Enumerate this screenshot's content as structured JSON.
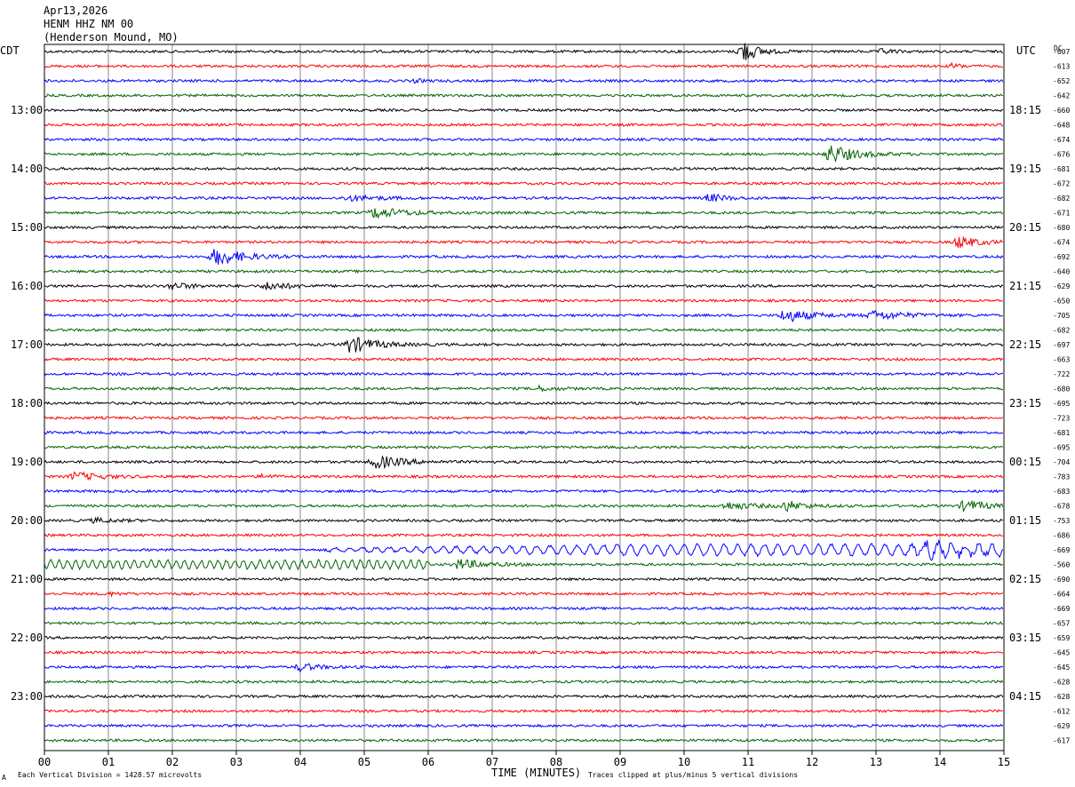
{
  "header": {
    "date": "Apr13,2026",
    "station": "HENM HHZ NM 00",
    "location": "(Henderson Mound, MO)"
  },
  "left_timezone": "CDT",
  "right_timezone": "UTC",
  "dc_label": "DC",
  "footer": {
    "xlabel": "TIME (MINUTES)",
    "scale_note": "Each Vertical Division = 1428.57 microvolts",
    "clip_note": "Traces clipped at plus/minus 5 vertical divisions",
    "corner_mark": "A"
  },
  "chart_data": {
    "type": "line",
    "subtype": "helicorder",
    "xlabel": "TIME (MINUTES)",
    "xlim": [
      0,
      15
    ],
    "x_ticks": [
      "00",
      "01",
      "02",
      "03",
      "04",
      "05",
      "06",
      "07",
      "08",
      "09",
      "10",
      "11",
      "12",
      "13",
      "14",
      "15"
    ],
    "trace_colors": [
      "#000000",
      "#ff0000",
      "#0000ff",
      "#006400"
    ],
    "left_hour_labels": [
      {
        "row": 4,
        "label": "13:00"
      },
      {
        "row": 8,
        "label": "14:00"
      },
      {
        "row": 12,
        "label": "15:00"
      },
      {
        "row": 16,
        "label": "16:00"
      },
      {
        "row": 20,
        "label": "17:00"
      },
      {
        "row": 24,
        "label": "18:00"
      },
      {
        "row": 28,
        "label": "19:00"
      },
      {
        "row": 32,
        "label": "20:00"
      },
      {
        "row": 36,
        "label": "21:00"
      },
      {
        "row": 40,
        "label": "22:00"
      },
      {
        "row": 44,
        "label": "23:00"
      }
    ],
    "right_hour_labels": [
      {
        "row": 4,
        "label": "18:15"
      },
      {
        "row": 8,
        "label": "19:15"
      },
      {
        "row": 12,
        "label": "20:15"
      },
      {
        "row": 16,
        "label": "21:15"
      },
      {
        "row": 20,
        "label": "22:15"
      },
      {
        "row": 24,
        "label": "23:15"
      },
      {
        "row": 28,
        "label": "00:15"
      },
      {
        "row": 32,
        "label": "01:15"
      },
      {
        "row": 36,
        "label": "02:15"
      },
      {
        "row": 40,
        "label": "03:15"
      },
      {
        "row": 44,
        "label": "04:15"
      }
    ],
    "dc_offsets": [
      "-607",
      "-613",
      "-652",
      "-642",
      "-660",
      "-648",
      "-674",
      "-676",
      "-681",
      "-672",
      "-682",
      "-671",
      "-680",
      "-674",
      "-692",
      "-640",
      "-629",
      "-650",
      "-705",
      "-682",
      "-697",
      "-663",
      "-722",
      "-680",
      "-695",
      "-723",
      "-681",
      "-695",
      "-704",
      "-783",
      "-683",
      "-678",
      "-753",
      "-686",
      "-669",
      "-560",
      "-690",
      "-664",
      "-669",
      "-657",
      "-659",
      "-645",
      "-645",
      "-628",
      "-628",
      "-612",
      "-629",
      "-617"
    ],
    "events": [
      {
        "row": 0,
        "minute": 10.9,
        "amp": 3.0,
        "dur": 0.35
      },
      {
        "row": 0,
        "minute": 13.1,
        "amp": 0.6,
        "dur": 0.3
      },
      {
        "row": 1,
        "minute": 14.2,
        "amp": 0.7,
        "dur": 0.2
      },
      {
        "row": 2,
        "minute": 5.8,
        "amp": 0.4,
        "dur": 0.2
      },
      {
        "row": 7,
        "minute": 12.3,
        "amp": 2.2,
        "dur": 0.6
      },
      {
        "row": 10,
        "minute": 4.8,
        "amp": 0.6,
        "dur": 0.8
      },
      {
        "row": 10,
        "minute": 10.4,
        "amp": 1.0,
        "dur": 0.4
      },
      {
        "row": 11,
        "minute": 5.2,
        "amp": 1.3,
        "dur": 0.7
      },
      {
        "row": 13,
        "minute": 14.3,
        "amp": 1.4,
        "dur": 0.5
      },
      {
        "row": 14,
        "minute": 2.7,
        "amp": 2.2,
        "dur": 0.6
      },
      {
        "row": 16,
        "minute": 2.0,
        "amp": 0.8,
        "dur": 0.5
      },
      {
        "row": 16,
        "minute": 3.5,
        "amp": 1.0,
        "dur": 0.5
      },
      {
        "row": 18,
        "minute": 11.6,
        "amp": 1.6,
        "dur": 0.6
      },
      {
        "row": 18,
        "minute": 13.0,
        "amp": 1.0,
        "dur": 0.8
      },
      {
        "row": 20,
        "minute": 4.8,
        "amp": 2.0,
        "dur": 0.6
      },
      {
        "row": 23,
        "minute": 7.7,
        "amp": 0.6,
        "dur": 0.4
      },
      {
        "row": 28,
        "minute": 5.2,
        "amp": 1.6,
        "dur": 0.6
      },
      {
        "row": 29,
        "minute": 0.5,
        "amp": 1.0,
        "dur": 0.6
      },
      {
        "row": 29,
        "minute": 3.4,
        "amp": 0.5,
        "dur": 0.3
      },
      {
        "row": 31,
        "minute": 10.7,
        "amp": 0.8,
        "dur": 0.7
      },
      {
        "row": 31,
        "minute": 11.6,
        "amp": 1.2,
        "dur": 0.4
      },
      {
        "row": 31,
        "minute": 14.4,
        "amp": 1.4,
        "dur": 0.5
      },
      {
        "row": 32,
        "minute": 0.8,
        "amp": 0.5,
        "dur": 0.5
      },
      {
        "row": 34,
        "minute": 13.8,
        "amp": 1.4,
        "dur": 1.2
      },
      {
        "row": 35,
        "minute": 6.5,
        "amp": 1.2,
        "dur": 0.6
      },
      {
        "row": 37,
        "minute": 1.0,
        "amp": 0.4,
        "dur": 0.3
      },
      {
        "row": 42,
        "minute": 4.0,
        "amp": 1.0,
        "dur": 0.4
      }
    ]
  }
}
